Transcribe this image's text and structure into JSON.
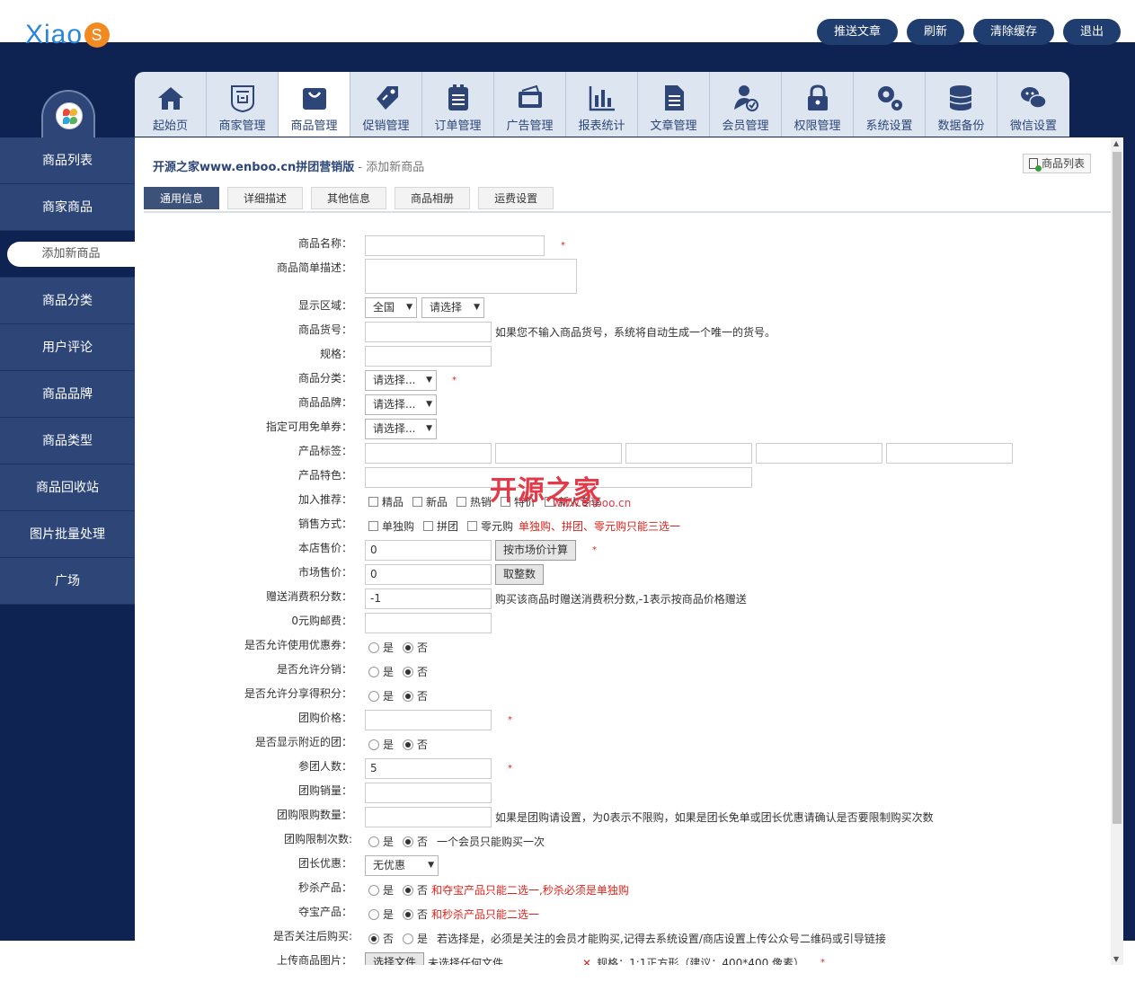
{
  "header": {
    "logo_text": "Xiao",
    "logo_badge": "S",
    "buttons": [
      "推送文章",
      "刷新",
      "清除缓存",
      "退出"
    ]
  },
  "top_tabs": [
    {
      "label": "起始页",
      "icon": "home-icon"
    },
    {
      "label": "商家管理",
      "icon": "shop-icon"
    },
    {
      "label": "商品管理",
      "icon": "bag-icon",
      "active": true
    },
    {
      "label": "促销管理",
      "icon": "tag-icon"
    },
    {
      "label": "订单管理",
      "icon": "clipboard-icon"
    },
    {
      "label": "广告管理",
      "icon": "folder-icon"
    },
    {
      "label": "报表统计",
      "icon": "bar-chart-icon"
    },
    {
      "label": "文章管理",
      "icon": "document-icon"
    },
    {
      "label": "会员管理",
      "icon": "user-check-icon"
    },
    {
      "label": "权限管理",
      "icon": "lock-icon"
    },
    {
      "label": "系统设置",
      "icon": "gears-icon"
    },
    {
      "label": "数据备份",
      "icon": "database-icon"
    },
    {
      "label": "微信设置",
      "icon": "wechat-icon"
    }
  ],
  "sidebar": {
    "items": [
      "商品列表",
      "商家商品",
      "添加新商品",
      "商品分类",
      "用户评论",
      "商品品牌",
      "商品类型",
      "商品回收站",
      "图片批量处理",
      "广场"
    ],
    "active_index": 2
  },
  "breadcrumb": {
    "site": "开源之家www.enboo.cn拼团营销版",
    "sep": " - ",
    "page": "添加新商品"
  },
  "list_button": "商品列表",
  "sub_tabs": [
    "通用信息",
    "详细描述",
    "其他信息",
    "商品相册",
    "运费设置"
  ],
  "star": "*",
  "form": {
    "name_label": "商品名称：",
    "brief_label": "商品简单描述：",
    "region_label": "显示区域：",
    "region_country": "全国",
    "region_select": "请选择",
    "sn_label": "商品货号：",
    "sn_tip": "如果您不输入商品货号，系统将自动生成一个唯一的货号。",
    "spec_label": "规格：",
    "cat_label": "商品分类：",
    "cat_value": "请选择...",
    "brand_label": "商品品牌：",
    "brand_value": "请选择...",
    "coupon_label": "指定可用免单券：",
    "coupon_value": "请选择...",
    "tags_label": "产品标签：",
    "feature_label": "产品特色：",
    "recommend_label": "加入推荐：",
    "recommend_options": [
      "精品",
      "新品",
      "热销",
      "特价",
      "新人专享"
    ],
    "sale_label": "销售方式：",
    "sale_options": [
      "单独购",
      "拼团",
      "零元购"
    ],
    "sale_tip": "单独购、拼团、零元购只能三选一",
    "price_label": "本店售价：",
    "price_value": "0",
    "price_btn": "按市场价计算",
    "market_label": "市场售价：",
    "market_value": "0",
    "market_btn": "取整数",
    "points_label": "赠送消费积分数：",
    "points_value": "-1",
    "points_tip": "购买该商品时赠送消费积分数,-1表示按商品价格赠送",
    "zero_ship_label": "0元购邮费：",
    "allow_coupon_label": "是否允许使用优惠券：",
    "allow_dist_label": "是否允许分销：",
    "allow_share_label": "是否允许分享得积分：",
    "yes": "是",
    "no": "否",
    "group_price_label": "团购价格：",
    "nearby_label": "是否显示附近的团：",
    "group_num_label": "参团人数：",
    "group_num_value": "5",
    "group_sales_label": "团购销量：",
    "group_limit_label": "团购限购数量：",
    "group_limit_tip": "如果是团购请设置，为0表示不限购，如果是团长免单或团长优惠请确认是否要限制购买次数",
    "group_times_label": "团购限制次数:",
    "group_times_tip": "一个会员只能购买一次",
    "leader_label": "团长优惠：",
    "leader_value": "无优惠",
    "seckill_label": "秒杀产品：",
    "seckill_tip": "和夺宝产品只能二选一,秒杀必须是单独购",
    "treasure_label": "夺宝产品：",
    "treasure_tip": "和秒杀产品只能二选一",
    "follow_label": "是否关注后购买:",
    "follow_tip": "若选择是，必须是关注的会员才能购买,记得去系统设置/商店设置上传公众号二维码或引导链接",
    "upload_label": "上传商品图片：",
    "upload_btn": "选择文件",
    "upload_none": "未选择任何文件",
    "upload_tip": "规格：1:1正方形（建议：400*400 像素）"
  },
  "watermark": {
    "text": "开源之家",
    "url": "www.enboo.cn"
  }
}
